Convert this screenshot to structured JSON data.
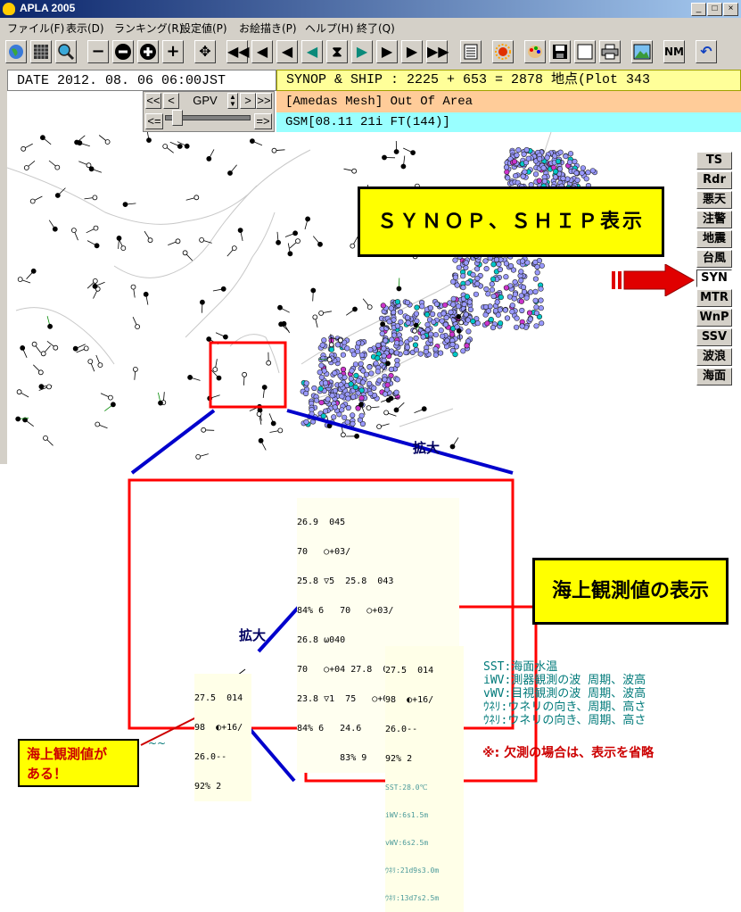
{
  "window": {
    "title": "APLA 2005",
    "min": "_",
    "max": "□",
    "close": "×"
  },
  "menu": [
    "ファイル(F)",
    "表示(D)",
    "ランキング(R)",
    "設定値(P)",
    "お絵描き(P)",
    "ヘルプ(H)",
    "終了(Q)"
  ],
  "toolbar": {
    "minus": "−",
    "minus_round": "−",
    "plus_round": "+",
    "plus": "+",
    "target": "✥",
    "first": "◀◀",
    "prev": "◀",
    "back": "◀",
    "back_teal": "◀",
    "center": "⧗",
    "fwd_teal": "▶",
    "fwd": "▶",
    "next": "▶",
    "last": "▶▶",
    "nm": "NM"
  },
  "info": {
    "date": "DATE 2012. 08. 06  06:00JST",
    "synop": "SYNOP & SHIP : 2225 + 653 = 2878 地点(Plot 343",
    "amedas": "[Amedas Mesh] Out Of Area",
    "gsm": "GSM[08.11 21i FT(144)]"
  },
  "gpv": {
    "label": "GPV",
    "left2": "<<",
    "left1": "<",
    "right1": ">",
    "right2": ">>",
    "slider_left": "<=",
    "slider_right": "=>"
  },
  "side_tabs": [
    "TS",
    "Rdr",
    "悪天",
    "注警",
    "地震",
    "台風",
    "SYN",
    "MTR",
    "WnP",
    "SSV",
    "波浪",
    "海面"
  ],
  "callouts": {
    "synop": "ＳＹＮＯＰ、ＳＨＩＰ表示",
    "marine": "海上観測値の表示",
    "exists": "海上観測値が\nある！",
    "zoom1": "拡大",
    "zoom2": "拡大"
  },
  "detail": {
    "line1": "27.5  014",
    "line2": "98  ◐+16/",
    "line3": "26.0--",
    "line4": "92% 2",
    "sst": "SST:28.0℃",
    "iwv": "iWV:6s1.5m",
    "vwv": "vWV:6s2.5m",
    "sw1": "ｳﾈﾘ:21d9s3.0m",
    "sw2": "ｳﾈﾘ:13d7s2.5m"
  },
  "small_plot": {
    "line1": "27.5  014",
    "line2": "98  ◐+16/",
    "line3": "26.0--",
    "line4": "92% 2"
  },
  "cluster": {
    "l1": "26.9  045",
    "l2": "70   ○+03/",
    "l3": "25.8 ▽5  25.8  043",
    "l4": "84% 6   70   ○+03/",
    "l5": "26.8 ω040",
    "l6": "70   ○+04 27.8  038 ▽2",
    "l7": "23.8 ▽1  75   ○+03/ 6",
    "l8": "84% 6   24.6",
    "l9": "        83% 9"
  },
  "legend": [
    "SST:海面水温",
    "iWV:測器観測の波  周期、波高",
    "vWV:目視観測の波  周期、波高",
    "ｳﾈﾘ:ウネリの向き、周期、高さ",
    "ｳﾈﾘ:ウネリの向き、周期、高さ"
  ],
  "note": "※: 欠測の場合は、表示を省略",
  "tilde": "~~",
  "colors": {
    "callout": "#ffff00",
    "highlight": "#ff0000",
    "connector": "#0000cc",
    "station_land": "#9999ff",
    "synop_bar": "#ffff99",
    "amedas_bar": "#ffcc99",
    "gsm_bar": "#99ffff"
  }
}
